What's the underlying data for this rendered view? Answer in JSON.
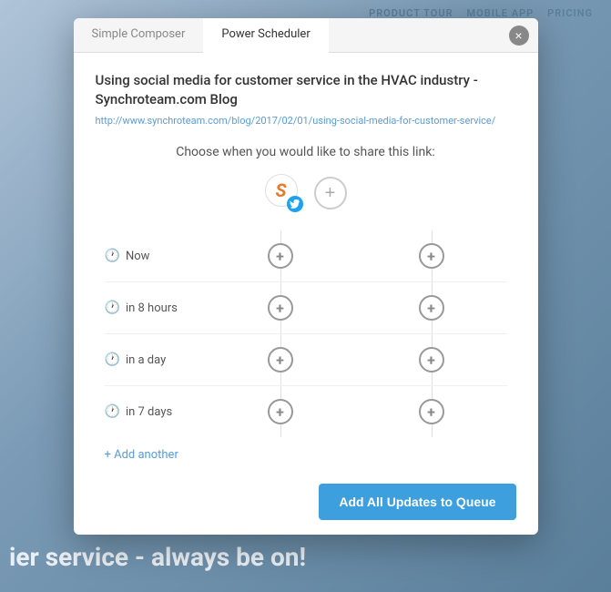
{
  "background": {
    "nav_items": [
      "PRODUCT TOUR",
      "MOBILE APP",
      "PRICING"
    ],
    "bottom_text": "ier service - always be on!"
  },
  "modal": {
    "tabs": [
      {
        "label": "Simple Composer",
        "active": false
      },
      {
        "label": "Power Scheduler",
        "active": true
      }
    ],
    "close_label": "×",
    "article_title": "Using social media for customer service in the HVAC industry - Synchroteam.com Blog",
    "article_url": "http://www.synchroteam.com/blog/2017/02/01/using-social-media-for-customer-service/",
    "choose_text": "Choose when you would like to share this link:",
    "accounts": [
      {
        "logo": "S",
        "network": "twitter"
      }
    ],
    "add_account_label": "+",
    "schedule_rows": [
      {
        "label": "Now",
        "icon": "clock"
      },
      {
        "label": "in 8 hours",
        "icon": "clock"
      },
      {
        "label": "in a day",
        "icon": "clock"
      },
      {
        "label": "in 7 days",
        "icon": "clock"
      }
    ],
    "add_another_label": "+ Add another",
    "submit_label": "Add All Updates to Queue"
  }
}
